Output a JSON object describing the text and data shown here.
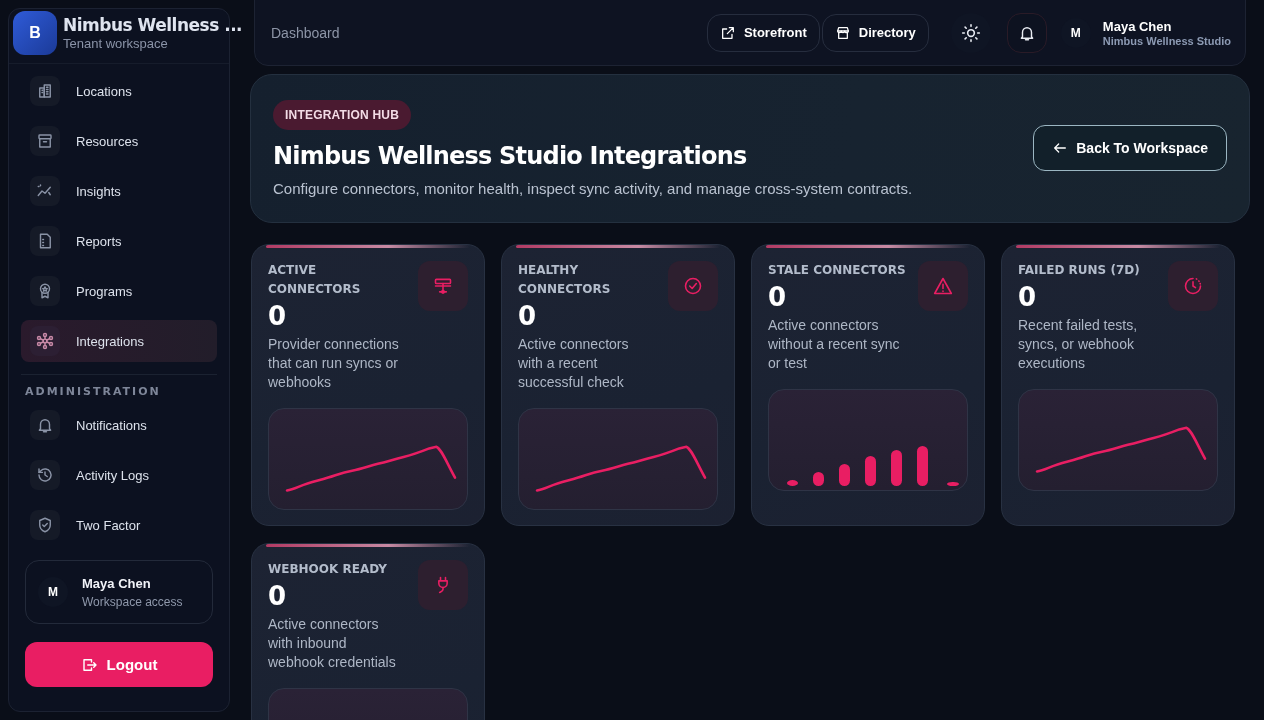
{
  "sidebar": {
    "brand": {
      "initial": "B",
      "name": "Nimbus Wellness ...",
      "subtitle": "Tenant workspace"
    },
    "sections": [
      {
        "items": [
          {
            "label": "Locations",
            "selected": false
          },
          {
            "label": "Resources",
            "selected": false
          },
          {
            "label": "Insights",
            "selected": false
          },
          {
            "label": "Reports",
            "selected": false
          },
          {
            "label": "Programs",
            "selected": false
          },
          {
            "label": "Integrations",
            "selected": true
          }
        ]
      },
      {
        "heading": "ADMINISTRATION",
        "items": [
          {
            "label": "Notifications",
            "selected": false
          },
          {
            "label": "Activity Logs",
            "selected": false
          },
          {
            "label": "Two Factor",
            "selected": false
          }
        ]
      }
    ],
    "user": {
      "initial": "M",
      "name": "Maya Chen",
      "role": "Workspace access"
    },
    "logout": "Logout"
  },
  "topbar": {
    "breadcrumb": "Dashboard",
    "links": [
      {
        "label": "Storefront"
      },
      {
        "label": "Directory"
      }
    ],
    "user": {
      "initial": "M",
      "name": "Maya Chen",
      "org": "Nimbus Wellness Studio"
    }
  },
  "hero": {
    "badge": "INTEGRATION HUB",
    "title": "Nimbus Wellness Studio Integrations",
    "description": "Configure connectors, monitor health, inspect sync activity, and manage cross-system contracts.",
    "back_button": "Back To Workspace"
  },
  "stats": [
    {
      "label": "ACTIVE CONNECTORS",
      "value": "0",
      "description": "Provider connections that can run syncs or webhooks",
      "kind": "line"
    },
    {
      "label": "HEALTHY CONNECTORS",
      "value": "0",
      "description": "Active connectors with a recent successful check",
      "kind": "line"
    },
    {
      "label": "STALE CONNECTORS",
      "value": "0",
      "description": "Active connectors without a recent sync or test",
      "kind": "bars"
    },
    {
      "label": "FAILED RUNS (7D)",
      "value": "0",
      "description": "Recent failed tests, syncs, or webhook executions",
      "kind": "line"
    },
    {
      "label": "WEBHOOK READY",
      "value": "0",
      "description": "Active connectors with inbound webhook credentials",
      "kind": "blank"
    }
  ]
}
